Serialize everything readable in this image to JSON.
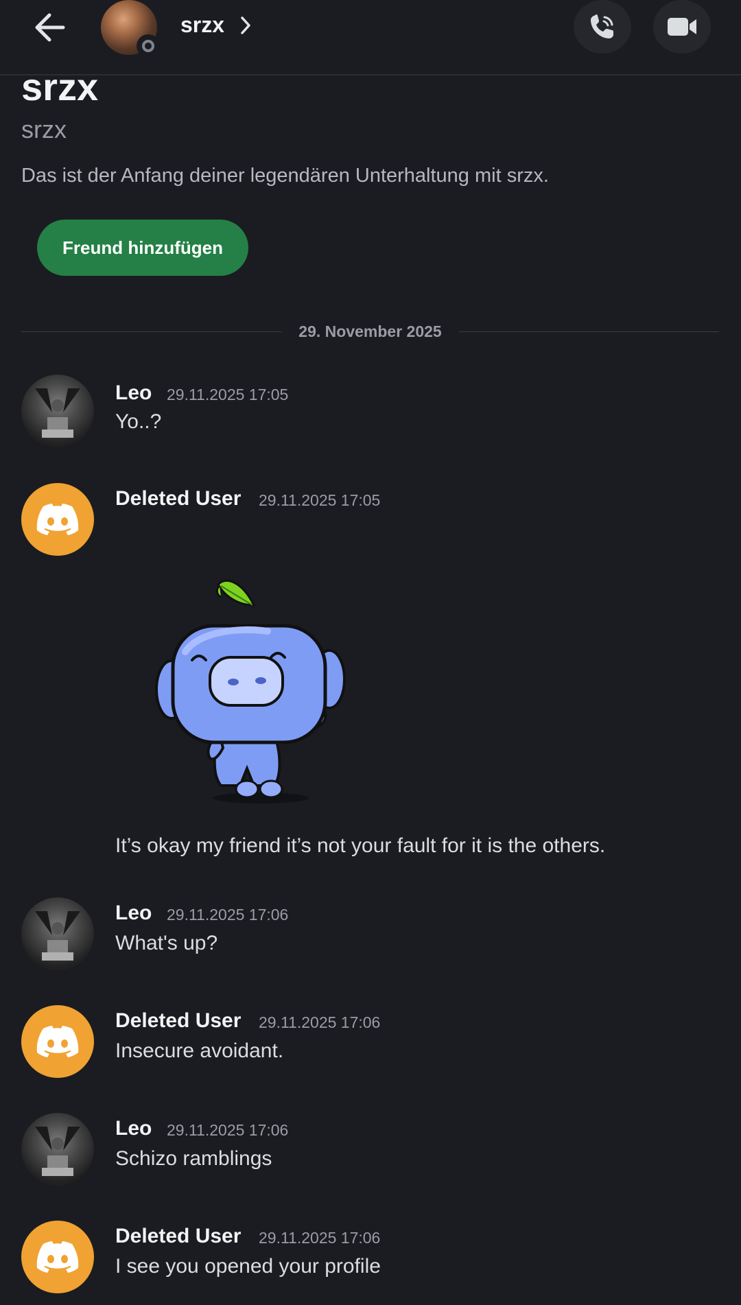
{
  "header": {
    "title": "srzx",
    "back_icon": "arrow-left-icon",
    "call_icon": "phone-icon",
    "video_icon": "video-camera-icon",
    "status": "offline"
  },
  "intro": {
    "display_name": "srzx",
    "username": "srzx",
    "description": "Das ist der Anfang deiner legendären Unterhaltung mit srzx.",
    "add_friend_label": "Freund hinzufügen"
  },
  "divider": {
    "date": "29. November 2025"
  },
  "colors": {
    "accent_green": "#248046",
    "discord_avatar": "#f0a232",
    "background": "#1b1c21"
  },
  "messages": [
    {
      "author": "Leo",
      "time": "29.11.2025 17:05",
      "text": "Yo..?"
    },
    {
      "author": "Deleted User",
      "time": "29.11.2025 17:05",
      "text": "It’s okay my friend it’s not your fault for it is the others.",
      "sticker": "wumpus-wave-sticker"
    },
    {
      "author": "Leo",
      "time": "29.11.2025 17:06",
      "text": "What's up?"
    },
    {
      "author": "Deleted User",
      "time": "29.11.2025 17:06",
      "text": "Insecure avoidant."
    },
    {
      "author": "Leo",
      "time": "29.11.2025 17:06",
      "text": "Schizo ramblings"
    },
    {
      "author": "Deleted User",
      "time": "29.11.2025 17:06",
      "text": "I see you opened your profile"
    }
  ]
}
